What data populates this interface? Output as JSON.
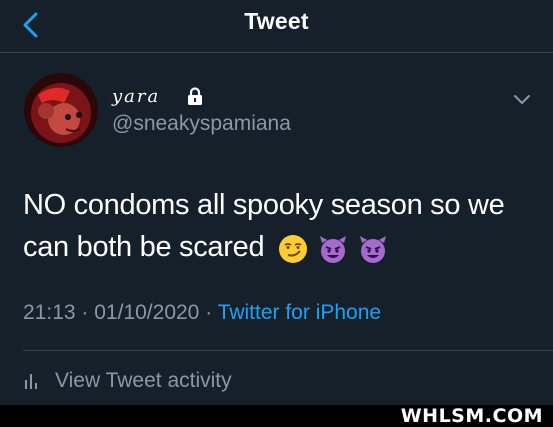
{
  "header": {
    "title": "Tweet",
    "back_icon": "chevron-left-icon"
  },
  "user": {
    "display_name": "yara",
    "handle": "@sneakyspamiana",
    "protected_icon": "lock-icon",
    "menu_icon": "chevron-down-icon"
  },
  "tweet": {
    "text": "NO condoms all spooky season so we can both be scared",
    "emojis": [
      "smirking-face-emoji",
      "smiling-imp-emoji",
      "smiling-imp-emoji"
    ],
    "time": "21:13",
    "date": "01/10/2020",
    "separator": "·",
    "source": "Twitter for iPhone"
  },
  "activity": {
    "label": "View Tweet activity",
    "icon": "bar-chart-icon"
  },
  "watermark": {
    "text": "WHLSM.COM"
  },
  "colors": {
    "background": "#15202b",
    "accent": "#1da1f2",
    "secondary_text": "#8899a6",
    "divider": "#38444d"
  }
}
